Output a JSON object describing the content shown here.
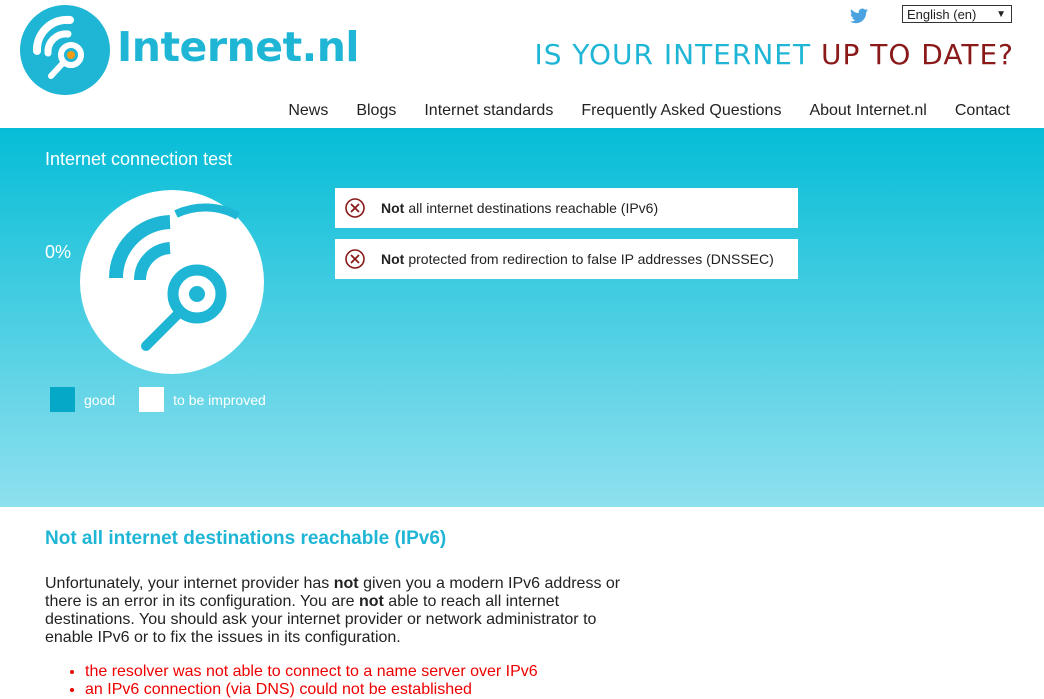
{
  "header": {
    "brand": "Internet.nl",
    "language": "English (en)",
    "tagline_part1": "IS YOUR INTERNET",
    "tagline_part2": "UP TO DATE?",
    "nav": [
      "News",
      "Blogs",
      "Internet standards",
      "Frequently Asked Questions",
      "About Internet.nl",
      "Contact"
    ]
  },
  "hero": {
    "title": "Internet connection test",
    "score": "0%",
    "legend_good": "good",
    "legend_bad": "to be improved",
    "results": [
      {
        "bold": "Not",
        "text": "all internet destinations reachable (IPv6)"
      },
      {
        "bold": "Not",
        "text": "protected from redirection to false IP addresses (DNSSEC)"
      }
    ]
  },
  "detail": {
    "heading": "Not all internet destinations reachable (IPv6)",
    "p1": "Unfortunately, your internet provider has",
    "p1_bold": "not",
    "p2": "given you a modern IPv6 address or there is an error in its configuration. You are",
    "p2_bold": "not",
    "p3": "able to reach all internet destinations. You should ask your internet provider or network administrator to enable IPv6 or to fix the issues in its configuration.",
    "errors": [
      "the resolver was not able to connect to a name server over IPv6",
      "an IPv6 connection (via DNS) could not be established"
    ]
  },
  "colors": {
    "brand": "#1fb6d6",
    "accent_red": "#8a1a1a",
    "error": "#e00000",
    "good": "#05a8c6"
  }
}
